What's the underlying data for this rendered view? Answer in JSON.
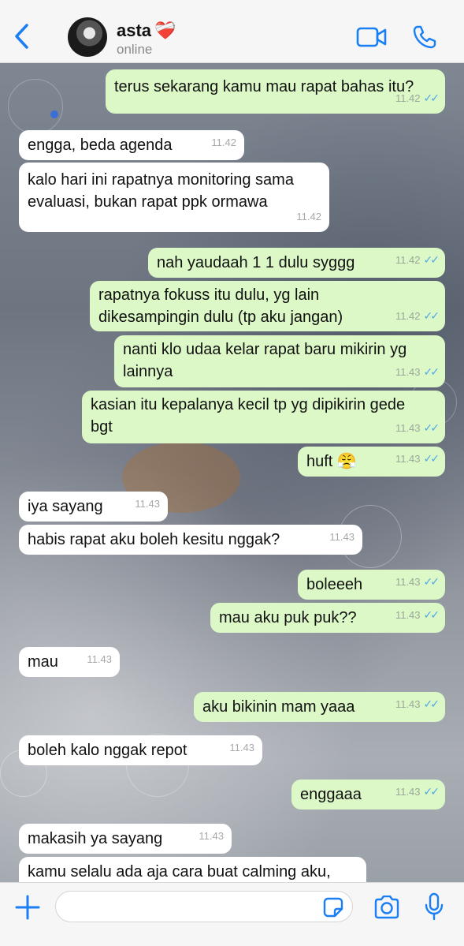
{
  "header": {
    "contact_name": "asta",
    "name_emoji": "❤️‍🩹",
    "status": "online",
    "accent_color": "#1a7ff5"
  },
  "messages": [
    {
      "dir": "out",
      "text": "terus sekarang kamu mau rapat bahas itu?",
      "time": "11.42",
      "ticks": "✓✓"
    },
    {
      "dir": "in",
      "text": "engga, beda agenda",
      "time": "11.42"
    },
    {
      "dir": "in",
      "text": "kalo hari ini rapatnya monitoring sama\nevaluasi, bukan rapat ppk ormawa",
      "time": "11.42"
    },
    {
      "dir": "out",
      "text": "nah yaudaah 1 1 dulu syggg",
      "time": "11.42",
      "ticks": "✓✓"
    },
    {
      "dir": "out",
      "text": "rapatnya fokuss itu dulu, yg lain\ndikesampingin dulu (tp aku jangan)",
      "time": "11.42",
      "ticks": "✓✓"
    },
    {
      "dir": "out",
      "text": "nanti klo udaa kelar rapat baru mikirin yg\nlainnya",
      "time": "11.43",
      "ticks": "✓✓"
    },
    {
      "dir": "out",
      "text": "kasian itu kepalanya kecil tp yg dipikirin gede\nbgt",
      "time": "11.43",
      "ticks": "✓✓"
    },
    {
      "dir": "out",
      "text": "huft 😤",
      "time": "11.43",
      "ticks": "✓✓"
    },
    {
      "dir": "in",
      "text": "iya sayang",
      "time": "11.43"
    },
    {
      "dir": "in",
      "text": "habis rapat aku boleh kesitu nggak?",
      "time": "11.43"
    },
    {
      "dir": "out",
      "text": "boleeeh",
      "time": "11.43",
      "ticks": "✓✓"
    },
    {
      "dir": "out",
      "text": "mau aku puk puk??",
      "time": "11.43",
      "ticks": "✓✓"
    },
    {
      "dir": "in",
      "text": "mau",
      "time": "11.43"
    },
    {
      "dir": "out",
      "text": "aku bikinin mam yaaa",
      "time": "11.43",
      "ticks": "✓✓"
    },
    {
      "dir": "in",
      "text": "boleh kalo nggak repot",
      "time": "11.43"
    },
    {
      "dir": "out",
      "text": "enggaaa",
      "time": "11.43",
      "ticks": "✓✓"
    },
    {
      "dir": "in",
      "text": "makasih ya sayang",
      "time": "11.43"
    },
    {
      "dir": "in",
      "text": "kamu selalu ada aja cara buat calming aku,",
      "time": ""
    }
  ],
  "input": {
    "placeholder": ""
  },
  "colors": {
    "outgoing_bubble": "#dcf8c6",
    "incoming_bubble": "#ffffff",
    "read_ticks": "#4fa6e9"
  },
  "icons": [
    "back-chevron-icon",
    "video-call-icon",
    "phone-icon",
    "plus-icon",
    "sticker-icon",
    "camera-icon",
    "microphone-icon"
  ]
}
